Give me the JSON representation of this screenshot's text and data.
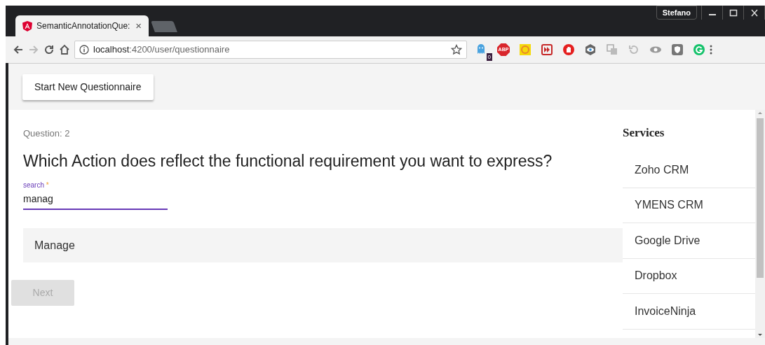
{
  "window": {
    "user": "Stefano"
  },
  "tabs": [
    {
      "title": "SemanticAnnotationQue:",
      "close": "×",
      "selected": true
    },
    {
      "selected": false
    }
  ],
  "address_bar": {
    "host": "localhost",
    "path": ":4200/user/questionnaire"
  },
  "extensions": [
    {
      "kind": "ghost",
      "badge": "0"
    },
    {
      "kind": "abp",
      "label": "ABP"
    },
    {
      "kind": "o"
    },
    {
      "kind": "ff"
    },
    {
      "kind": "hand"
    },
    {
      "kind": "eye-hex"
    },
    {
      "kind": "copy"
    },
    {
      "kind": "history"
    },
    {
      "kind": "eye"
    },
    {
      "kind": "shield"
    },
    {
      "kind": "g"
    }
  ],
  "page": {
    "start_button": "Start New Questionnaire",
    "question_number": "Question: 2",
    "question": "Which Action does reflect the functional requirement you want to express?",
    "search": {
      "label": "search",
      "required_mark": "*",
      "value": "manag"
    },
    "results": [
      {
        "label": "Manage"
      }
    ],
    "next_button": {
      "label": "Next",
      "disabled": true
    }
  },
  "services": {
    "title": "Services",
    "items": [
      {
        "label": "Zoho CRM"
      },
      {
        "label": "YMENS CRM"
      },
      {
        "label": "Google Drive"
      },
      {
        "label": "Dropbox"
      },
      {
        "label": "InvoiceNinja"
      }
    ]
  }
}
